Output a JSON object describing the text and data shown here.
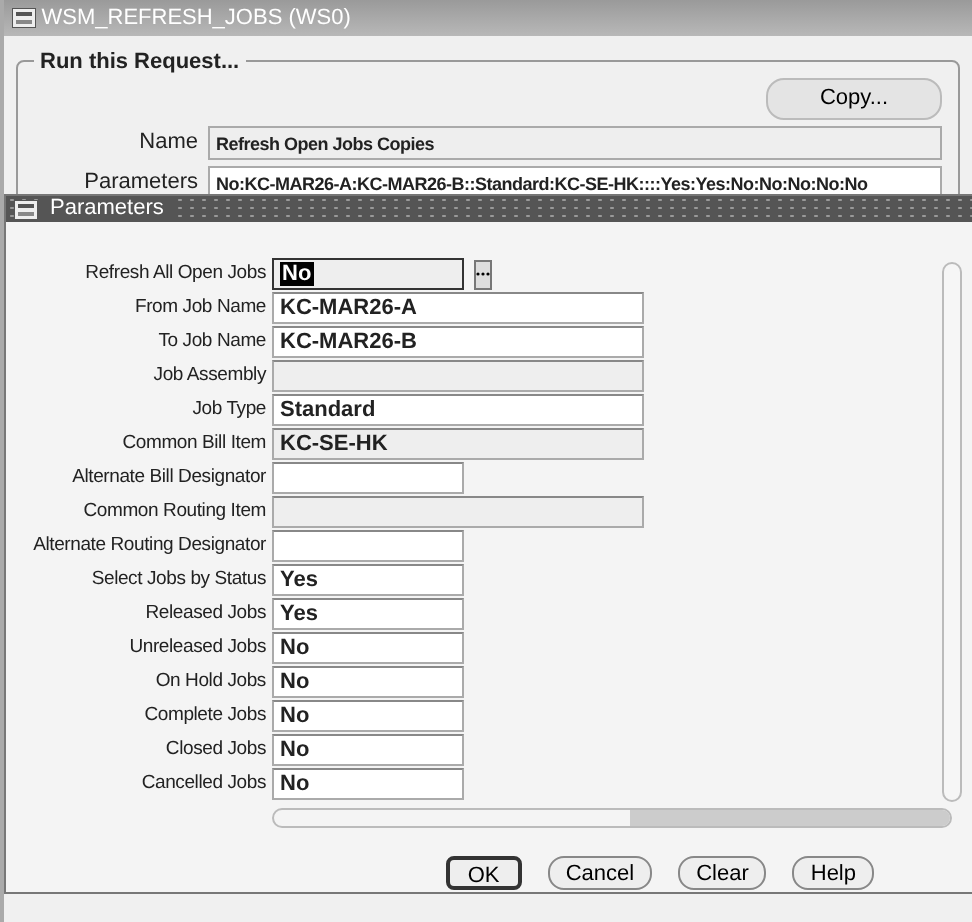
{
  "window": {
    "title": "WSM_REFRESH_JOBS (WS0)"
  },
  "request": {
    "legend": "Run this Request...",
    "copy_button": "Copy...",
    "rows": [
      {
        "label": "Name",
        "value": "Refresh Open Jobs Copies",
        "disabled": true
      },
      {
        "label": "Parameters",
        "value": "No:KC-MAR26-A:KC-MAR26-B::Standard:KC-SE-HK::::Yes:Yes:No:No:No:No:No",
        "disabled": false
      }
    ]
  },
  "dialog": {
    "title": "Parameters",
    "fields": [
      {
        "label": "Refresh All Open Jobs",
        "value": "No",
        "kind": "lov",
        "disabled": true,
        "selected": true
      },
      {
        "label": "From Job Name",
        "value": "KC-MAR26-A",
        "kind": "wide",
        "disabled": false,
        "selected": false
      },
      {
        "label": "To Job Name",
        "value": "KC-MAR26-B",
        "kind": "wide",
        "disabled": false,
        "selected": false
      },
      {
        "label": "Job Assembly",
        "kind": "wide",
        "disabled": true,
        "selected": false
      },
      {
        "label": "Job Type",
        "value": "Standard",
        "kind": "wide",
        "disabled": false,
        "selected": false
      },
      {
        "label": "Common Bill Item",
        "value": "KC-SE-HK",
        "kind": "wide",
        "disabled": true,
        "selected": false
      },
      {
        "label": "Alternate Bill Designator",
        "kind": "short",
        "disabled": false,
        "selected": false
      },
      {
        "label": "Common Routing Item",
        "kind": "wide",
        "disabled": true,
        "selected": false
      },
      {
        "label": "Alternate Routing Designator",
        "kind": "short",
        "disabled": false,
        "selected": false
      },
      {
        "label": "Select Jobs by Status",
        "value": "Yes",
        "kind": "short",
        "disabled": false,
        "selected": false
      },
      {
        "label": "Released Jobs",
        "value": "Yes",
        "kind": "short",
        "disabled": false,
        "selected": false
      },
      {
        "label": "Unreleased Jobs",
        "value": "No",
        "kind": "short",
        "disabled": false,
        "selected": false
      },
      {
        "label": "On Hold Jobs",
        "value": "No",
        "kind": "short",
        "disabled": false,
        "selected": false
      },
      {
        "label": "Complete Jobs",
        "value": "No",
        "kind": "short",
        "disabled": false,
        "selected": false
      },
      {
        "label": "Closed Jobs",
        "value": "No",
        "kind": "short",
        "disabled": false,
        "selected": false
      },
      {
        "label": "Cancelled Jobs",
        "value": "No",
        "kind": "short",
        "disabled": false,
        "selected": false
      }
    ],
    "buttons": [
      {
        "label": "OK",
        "default": true
      },
      {
        "label": "Cancel",
        "default": false
      },
      {
        "label": "Clear",
        "default": false
      },
      {
        "label": "Help",
        "default": false
      }
    ]
  }
}
